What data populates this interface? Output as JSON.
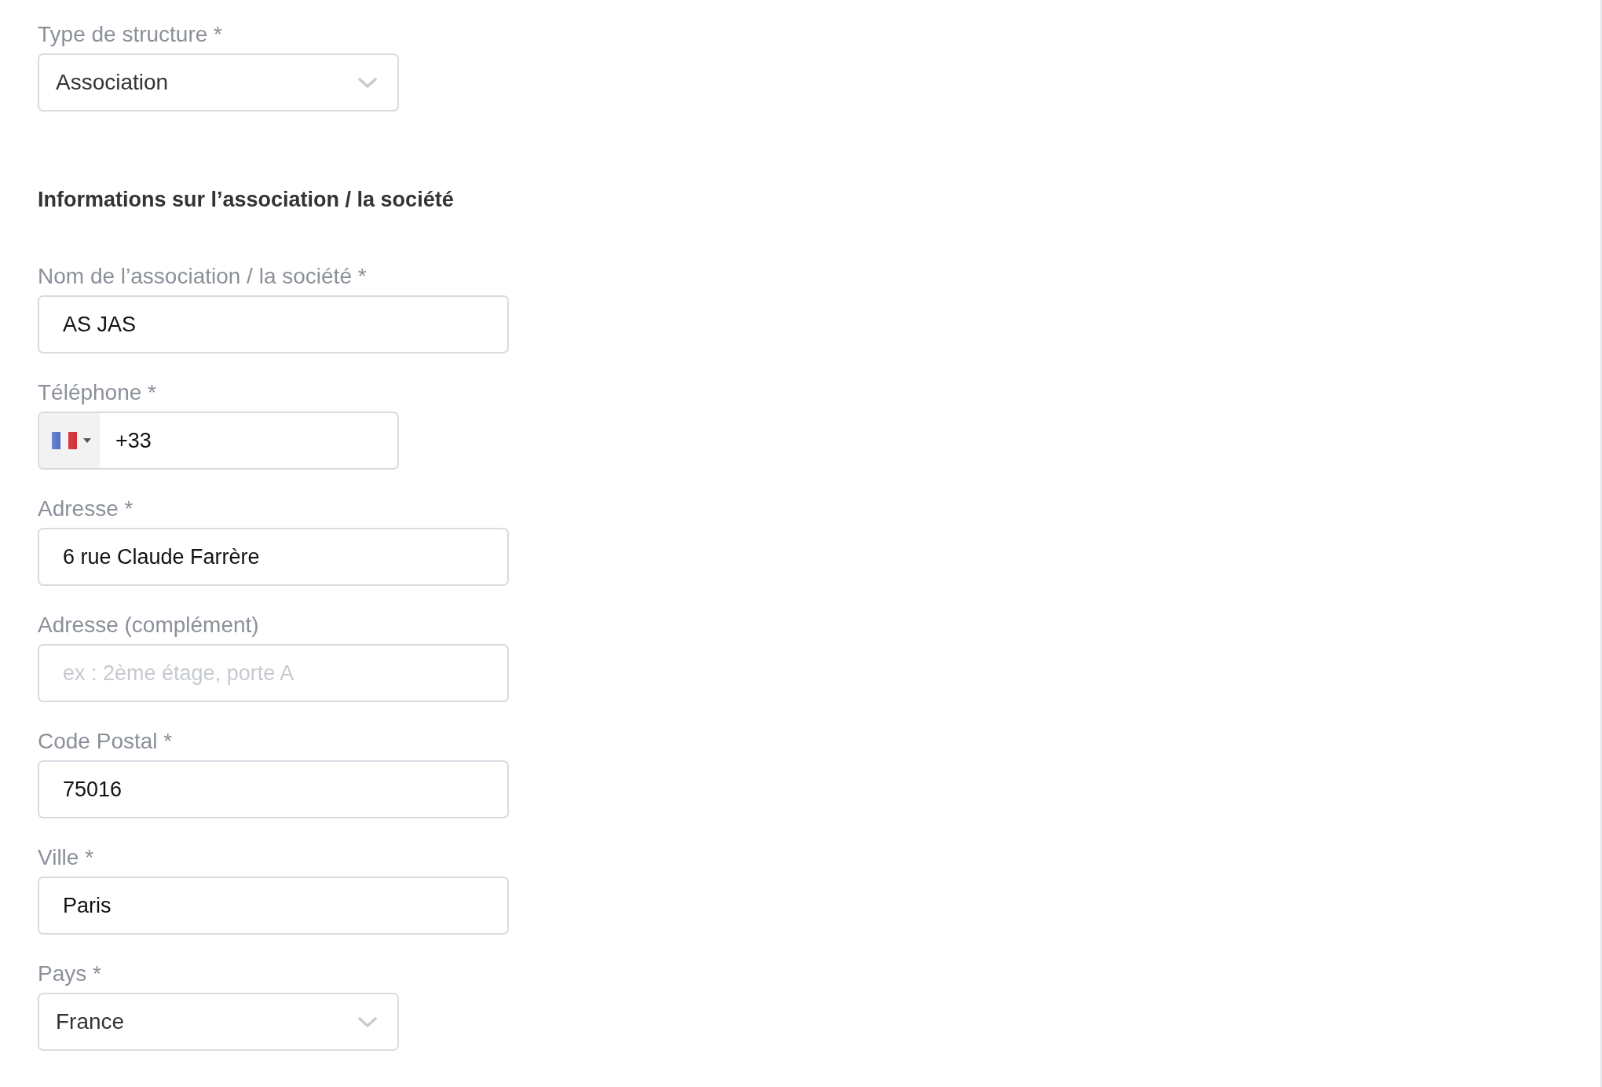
{
  "structure_type": {
    "kind": "select",
    "label": "Type de structure *",
    "value": "Association"
  },
  "section": {
    "title": "Informations sur l’association / la société"
  },
  "fields": [
    {
      "kind": "text",
      "label": "Nom de l’association / la société *",
      "value": "AS JAS"
    },
    {
      "kind": "phone",
      "label": "Téléphone *",
      "value": "+33"
    },
    {
      "kind": "text",
      "label": "Adresse *",
      "value": "6 rue Claude Farrère"
    },
    {
      "kind": "text",
      "label": "Adresse (complément)",
      "placeholder": "ex : 2ème étage, porte A"
    },
    {
      "kind": "text",
      "label": "Code Postal *",
      "value": "75016"
    },
    {
      "kind": "text",
      "label": "Ville *",
      "value": "Paris"
    },
    {
      "kind": "select",
      "label": "Pays *",
      "value": "France"
    }
  ]
}
